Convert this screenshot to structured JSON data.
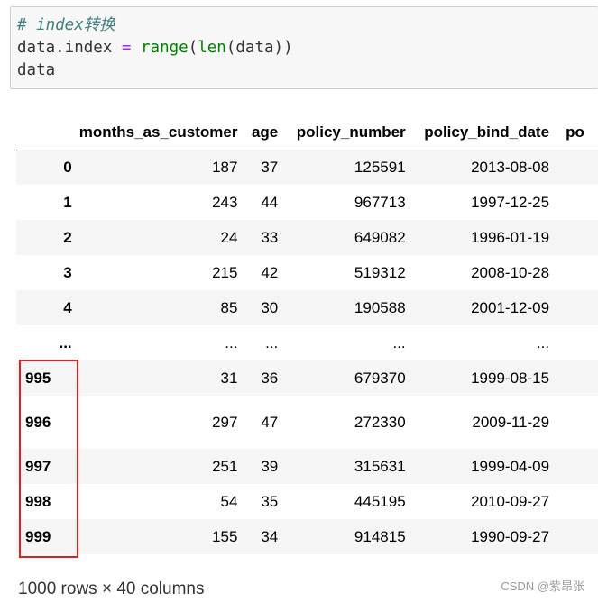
{
  "code": {
    "comment": "# index转换",
    "line2": {
      "var": "data.index",
      "op": "=",
      "fn_range": "range",
      "fn_len": "len",
      "arg": "data"
    },
    "line3": "data"
  },
  "dataframe": {
    "columns": [
      "months_as_customer",
      "age",
      "policy_number",
      "policy_bind_date",
      "po"
    ],
    "rows": [
      {
        "index": "0",
        "months_as_customer": "187",
        "age": "37",
        "policy_number": "125591",
        "policy_bind_date": "2013-08-08"
      },
      {
        "index": "1",
        "months_as_customer": "243",
        "age": "44",
        "policy_number": "967713",
        "policy_bind_date": "1997-12-25"
      },
      {
        "index": "2",
        "months_as_customer": "24",
        "age": "33",
        "policy_number": "649082",
        "policy_bind_date": "1996-01-19"
      },
      {
        "index": "3",
        "months_as_customer": "215",
        "age": "42",
        "policy_number": "519312",
        "policy_bind_date": "2008-10-28"
      },
      {
        "index": "4",
        "months_as_customer": "85",
        "age": "30",
        "policy_number": "190588",
        "policy_bind_date": "2001-12-09"
      },
      {
        "index": "...",
        "months_as_customer": "...",
        "age": "...",
        "policy_number": "...",
        "policy_bind_date": "..."
      },
      {
        "index": "995",
        "months_as_customer": "31",
        "age": "36",
        "policy_number": "679370",
        "policy_bind_date": "1999-08-15"
      },
      {
        "index": "996",
        "months_as_customer": "297",
        "age": "47",
        "policy_number": "272330",
        "policy_bind_date": "2009-11-29"
      },
      {
        "index": "997",
        "months_as_customer": "251",
        "age": "39",
        "policy_number": "315631",
        "policy_bind_date": "1999-04-09"
      },
      {
        "index": "998",
        "months_as_customer": "54",
        "age": "35",
        "policy_number": "445195",
        "policy_bind_date": "2010-09-27"
      },
      {
        "index": "999",
        "months_as_customer": "155",
        "age": "34",
        "policy_number": "914815",
        "policy_bind_date": "1990-09-27"
      }
    ],
    "shape_text": "1000 rows × 40 columns"
  },
  "watermark": "CSDN @紫昂张",
  "colors": {
    "highlight_border": "#e02020",
    "comment": "#408080",
    "keyword": "#aa22ff",
    "builtin": "#008000"
  }
}
